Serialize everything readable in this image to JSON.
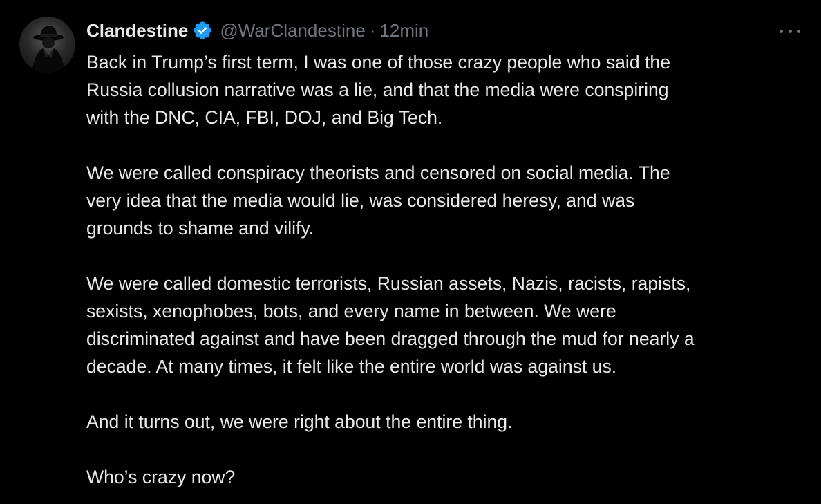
{
  "author": {
    "display_name": "Clandestine",
    "handle": "@WarClandestine",
    "separator": "·",
    "timestamp": "12min",
    "verified": true,
    "verified_color": "#1d9bf0"
  },
  "actions": {
    "more_icon": "more-horizontal-icon"
  },
  "body": {
    "paragraphs": [
      [
        "Back in Trump’s first term, I was one of those crazy people who said the",
        "Russia collusion narrative was a lie, and that the media were conspiring",
        "with the DNC, CIA, FBI, DOJ, and Big Tech."
      ],
      [
        "We were called conspiracy theorists and censored on social media. The",
        "very idea that the media would lie, was considered heresy, and was",
        "grounds to shame and vilify."
      ],
      [
        "We were called domestic terrorists, Russian assets, Nazis, racists, rapists,",
        "sexists, xenophobes, bots, and every name in between. We were",
        "discriminated against and have been dragged through the mud for nearly a",
        "decade. At many times, it felt like the entire world was against us."
      ],
      [
        "And it turns out, we were right about the entire thing."
      ],
      [
        "Who’s crazy now?"
      ]
    ]
  },
  "colors": {
    "background": "#000000",
    "text_primary": "#e7e9ea",
    "text_secondary": "#71767b"
  }
}
